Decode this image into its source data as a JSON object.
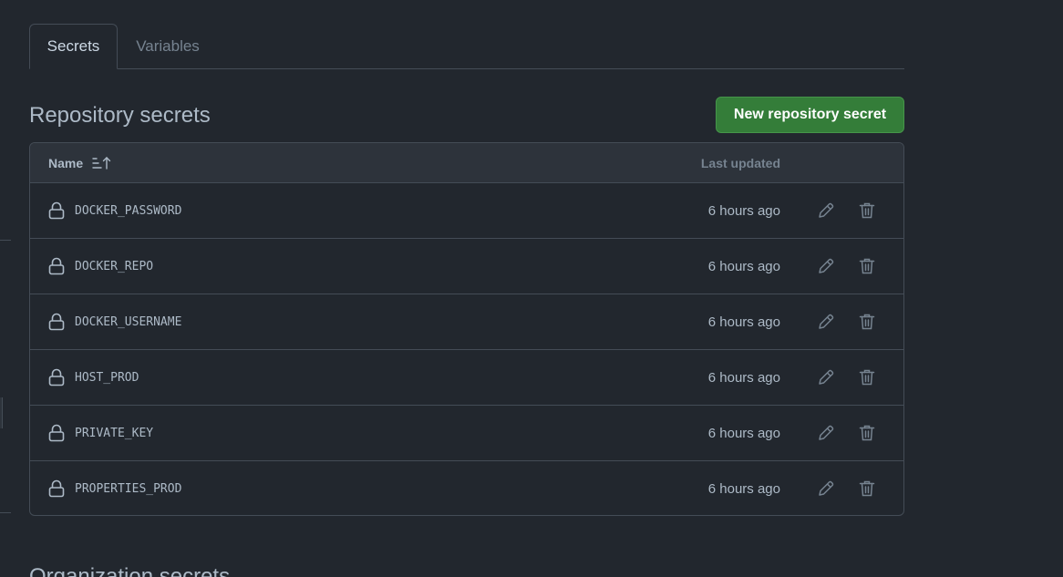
{
  "tabs": [
    {
      "label": "Secrets",
      "active": true
    },
    {
      "label": "Variables",
      "active": false
    }
  ],
  "repository_secrets": {
    "title": "Repository secrets",
    "new_button_label": "New repository secret",
    "columns": {
      "name": "Name",
      "updated": "Last updated"
    },
    "rows": [
      {
        "name": "DOCKER_PASSWORD",
        "updated": "6 hours ago"
      },
      {
        "name": "DOCKER_REPO",
        "updated": "6 hours ago"
      },
      {
        "name": "DOCKER_USERNAME",
        "updated": "6 hours ago"
      },
      {
        "name": "HOST_PROD",
        "updated": "6 hours ago"
      },
      {
        "name": "PRIVATE_KEY",
        "updated": "6 hours ago"
      },
      {
        "name": "PROPERTIES_PROD",
        "updated": "6 hours ago"
      }
    ]
  },
  "organization_secrets": {
    "title": "Organization secrets"
  },
  "colors": {
    "background": "#22272e",
    "border": "#444c56",
    "accent_button": "#347d39",
    "icon": "#768390"
  }
}
